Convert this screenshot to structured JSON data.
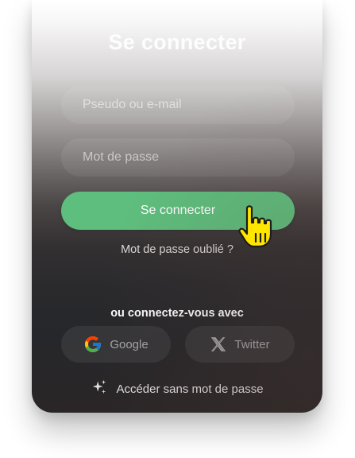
{
  "login": {
    "title": "Se connecter",
    "username_placeholder": "Pseudo ou e-mail",
    "password_placeholder": "Mot de passe",
    "submit_label": "Se connecter",
    "forgot_label": "Mot de passe oublié ?"
  },
  "social": {
    "heading": "ou connectez-vous avec",
    "google_label": "Google",
    "twitter_label": "Twitter"
  },
  "passwordless": {
    "label": "Accéder sans mot de passe"
  },
  "colors": {
    "accent": "#5ebe7d",
    "cursor": "#ffe600"
  },
  "icons": [
    "google-icon",
    "x-twitter-icon",
    "sparkles-icon",
    "hand-pointer-cursor-icon"
  ]
}
